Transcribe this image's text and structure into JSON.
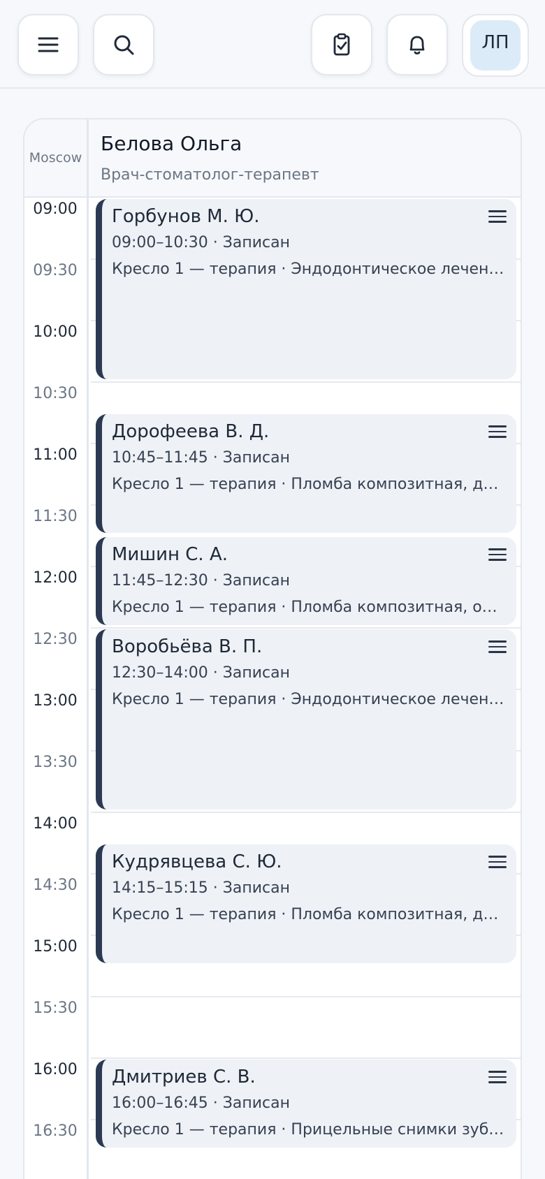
{
  "topbar": {
    "menu_icon": "hamburger-icon",
    "search_icon": "search-icon",
    "tasks_icon": "clipboard-check-icon",
    "notifications_icon": "bell-icon",
    "avatar_initials": "ЛП"
  },
  "calendar": {
    "timezone": "Moscow",
    "doctor": {
      "name": "Белова Ольга",
      "role": "Врач-стоматолог-терапевт"
    },
    "times": [
      {
        "label": "09:00",
        "type": "hour"
      },
      {
        "label": "09:30",
        "type": "half"
      },
      {
        "label": "10:00",
        "type": "hour"
      },
      {
        "label": "10:30",
        "type": "half"
      },
      {
        "label": "11:00",
        "type": "hour"
      },
      {
        "label": "11:30",
        "type": "half"
      },
      {
        "label": "12:00",
        "type": "hour"
      },
      {
        "label": "12:30",
        "type": "half"
      },
      {
        "label": "13:00",
        "type": "hour"
      },
      {
        "label": "13:30",
        "type": "half"
      },
      {
        "label": "14:00",
        "type": "hour"
      },
      {
        "label": "14:30",
        "type": "half"
      },
      {
        "label": "15:00",
        "type": "hour"
      },
      {
        "label": "15:30",
        "type": "half"
      },
      {
        "label": "16:00",
        "type": "hour"
      },
      {
        "label": "16:30",
        "type": "half"
      }
    ],
    "appointments": [
      {
        "patient": "Горбунов М. Ю.",
        "time": "09:00–10:30 · Записан",
        "details": "Кресло 1 — терапия · Эндодонтическое лечение канала",
        "start": "09:00",
        "end": "10:30"
      },
      {
        "patient": "Дорофеева В. Д.",
        "time": "10:45–11:45 · Записан",
        "details": "Кресло 1 — терапия · Пломба композитная, две поверхности",
        "start": "10:45",
        "end": "11:45"
      },
      {
        "patient": "Мишин С. А.",
        "time": "11:45–12:30 · Записан",
        "details": "Кресло 1 — терапия · Пломба композитная, одна поверхность",
        "start": "11:45",
        "end": "12:30"
      },
      {
        "patient": "Воробьёва В. П.",
        "time": "12:30–14:00 · Записан",
        "details": "Кресло 1 — терапия · Эндодонтическое лечение канала",
        "start": "12:30",
        "end": "14:00"
      },
      {
        "patient": "Кудрявцева С. Ю.",
        "time": "14:15–15:15 · Записан",
        "details": "Кресло 1 — терапия · Пломба композитная, две поверхности",
        "start": "14:15",
        "end": "15:15"
      },
      {
        "patient": "Дмитриев С. В.",
        "time": "16:00–16:45 · Записан",
        "details": "Кресло 1 — терапия · Прицельные снимки зубов",
        "start": "16:00",
        "end": "16:45"
      }
    ],
    "appointment_menu_icon": "menu-lines-icon"
  }
}
